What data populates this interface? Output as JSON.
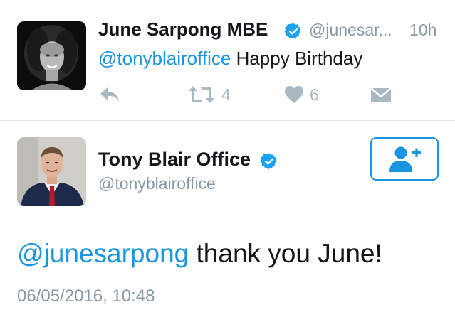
{
  "reply_tweet": {
    "author_name": "June Sarpong MBE",
    "handle": "@junesar...",
    "time": "10h",
    "mention": "@tonyblairoffice",
    "text": " Happy Birthday",
    "retweet_count": "4",
    "like_count": "6"
  },
  "main_tweet": {
    "author_name": "Tony Blair Office",
    "handle": "@tonyblairoffice",
    "mention": "@junesarpong",
    "text": " thank you June!",
    "timestamp": "06/05/2016, 10:48"
  },
  "colors": {
    "link": "#1b95e0",
    "verified": "#1da1f2",
    "muted": "#8899a6",
    "action": "#aab8c2"
  },
  "icons": {
    "verified": "verified-badge-icon",
    "reply": "reply-icon",
    "retweet": "retweet-icon",
    "like": "heart-icon",
    "dm": "envelope-icon",
    "follow": "add-user-icon"
  }
}
